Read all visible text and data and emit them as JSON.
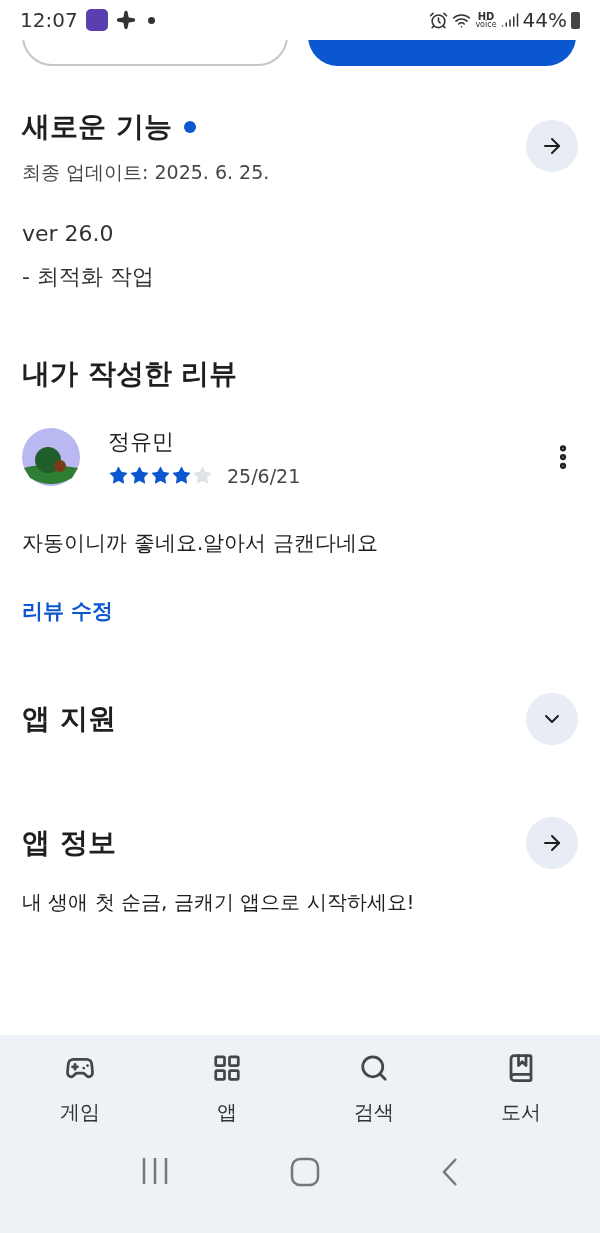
{
  "status_bar": {
    "time": "12:07",
    "network_badge": [
      "HD",
      "voice"
    ],
    "battery": "44%"
  },
  "whats_new": {
    "title": "새로운 기능",
    "has_new": true,
    "updated": "최종 업데이트: 2025. 6. 25.",
    "lines": [
      "ver 26.0",
      "- 최적화 작업"
    ]
  },
  "my_review": {
    "title": "내가 작성한 리뷰",
    "author": "정유민",
    "stars": 4,
    "date": "25/6/21",
    "text": "자동이니까 좋네요.알아서 금캔다네요",
    "edit_link": "리뷰 수정"
  },
  "sections": [
    {
      "title": "앱 지원",
      "kind": "expand"
    },
    {
      "title": "앱 정보",
      "kind": "arrow"
    }
  ],
  "app_description": "내 생애 첫 순금, 금캐기 앱으로 시작하세요!",
  "bottom_nav": [
    {
      "label": "게임",
      "kind": "games"
    },
    {
      "label": "앱",
      "kind": "apps"
    },
    {
      "label": "검색",
      "kind": "search"
    },
    {
      "label": "도서",
      "kind": "books"
    }
  ]
}
